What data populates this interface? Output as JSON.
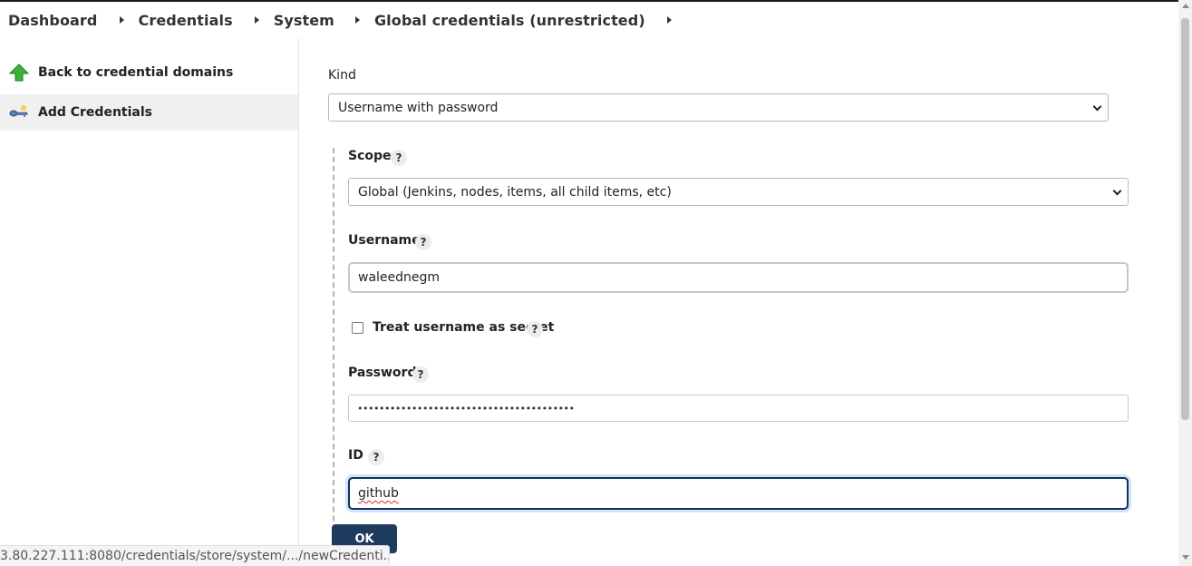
{
  "breadcrumb": {
    "items": [
      "Dashboard",
      "Credentials",
      "System",
      "Global credentials (unrestricted)"
    ]
  },
  "sidebar": {
    "items": [
      {
        "label": "Back to credential domains",
        "icon": "up-arrow-icon"
      },
      {
        "label": "Add Credentials",
        "icon": "key-icon"
      }
    ]
  },
  "form": {
    "kind_label": "Kind",
    "kind_value": "Username with password",
    "scope_label": "Scope",
    "scope_value": "Global (Jenkins, nodes, items, all child items, etc)",
    "username_label": "Username",
    "username_value": "waleednegm",
    "treat_secret_label": "Treat username as secret",
    "treat_secret_checked": false,
    "password_label": "Password",
    "password_value": "••••••••••••••••••••••••••••••••••••••••",
    "id_label": "ID",
    "id_value": "github",
    "help_glyph": "?",
    "ok_label": "OK"
  },
  "status_url": "3.80.227.111:8080/credentials/store/system/.../newCredenti...",
  "colors": {
    "primary_button": "#1e3a5f",
    "focus_border": "#12315e",
    "active_sidebar": "#f0f0f0",
    "arrow_green": "#3bb33b"
  }
}
